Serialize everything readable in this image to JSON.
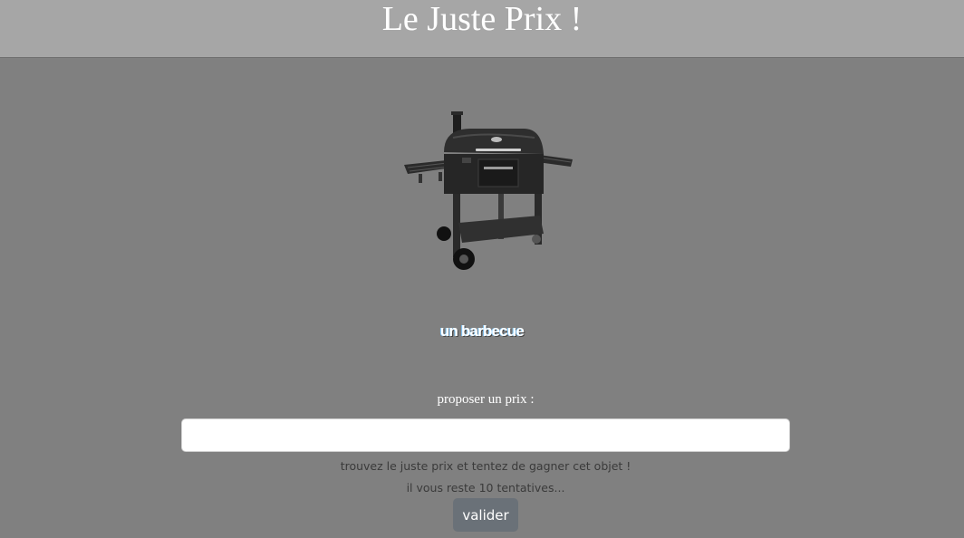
{
  "header": {
    "title": "Le Juste Prix !"
  },
  "product": {
    "name": "un barbecue",
    "image": "barbecue-grill-image"
  },
  "form": {
    "label": "proposer un prix :",
    "input_value": "",
    "input_placeholder": "",
    "hint": "trouvez le juste prix et tentez de gagner cet objet !",
    "attempts_text": "il vous reste 10 tentatives...",
    "submit_label": "valider"
  },
  "colors": {
    "page_background": "#808080",
    "header_background": "#a6a6a6",
    "button_background": "#6a7178"
  }
}
